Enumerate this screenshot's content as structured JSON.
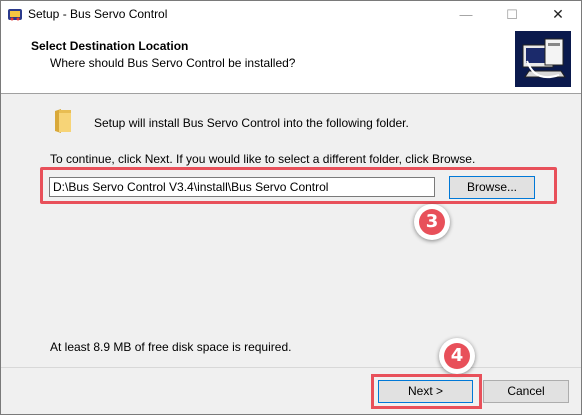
{
  "window": {
    "title": "Setup - Bus Servo Control",
    "minimize_glyph": "—",
    "maximize_glyph": "☐",
    "close_glyph": "✕"
  },
  "header": {
    "title": "Select Destination Location",
    "subtitle": "Where should Bus Servo Control be installed?"
  },
  "body": {
    "intro": "Setup will install Bus Servo Control into the following folder.",
    "continue": "To continue, click Next. If you would like to select a different folder, click Browse.",
    "path_value": "D:\\Bus Servo Control V3.4\\install\\Bus Servo Control",
    "browse_label": "Browse...",
    "disk_space": "At least 8.9 MB of free disk space is required."
  },
  "annotations": {
    "step3": "3",
    "step4": "4",
    "highlight_color": "#e8505a"
  },
  "footer": {
    "next_label": "Next >",
    "cancel_label": "Cancel"
  },
  "icons": [
    "app-icon",
    "setup-logo-icon",
    "folder-icon"
  ]
}
